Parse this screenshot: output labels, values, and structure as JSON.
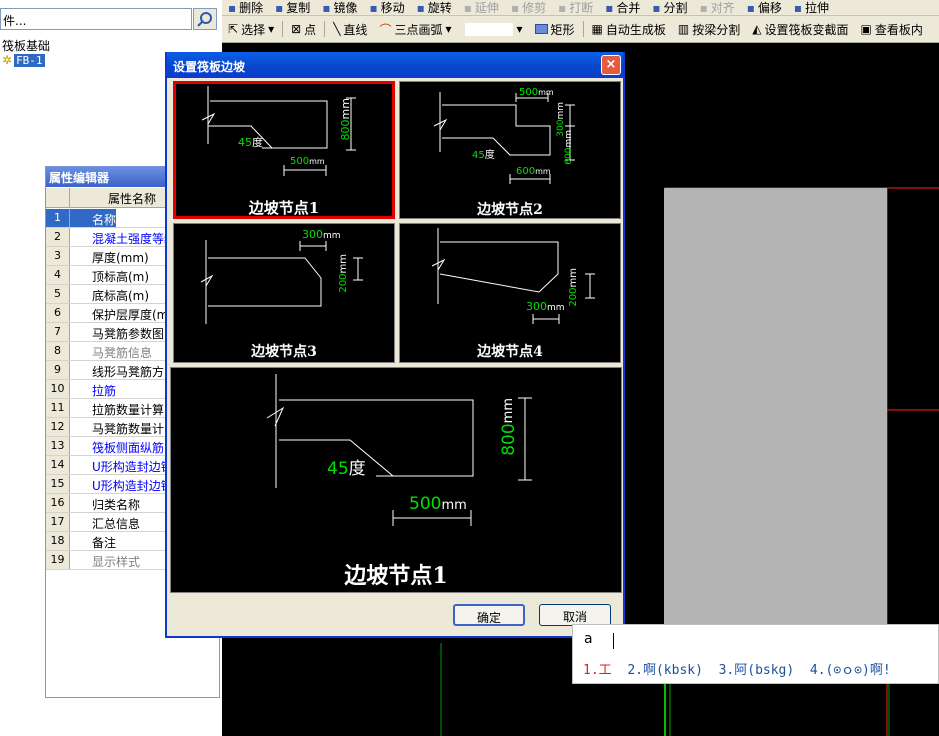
{
  "toolbar_top": {
    "items": [
      {
        "label": "删除",
        "disabled": false
      },
      {
        "label": "复制",
        "disabled": false
      },
      {
        "label": "镜像",
        "disabled": false
      },
      {
        "label": "移动",
        "disabled": false
      },
      {
        "label": "旋转",
        "disabled": false
      },
      {
        "label": "延伸",
        "disabled": true
      },
      {
        "label": "修剪",
        "disabled": true
      },
      {
        "label": "打断",
        "disabled": true
      },
      {
        "label": "合并",
        "disabled": false
      },
      {
        "label": "分割",
        "disabled": false
      },
      {
        "label": "对齐",
        "disabled": true
      },
      {
        "label": "偏移",
        "disabled": false
      },
      {
        "label": "拉伸",
        "disabled": false
      }
    ]
  },
  "toolbar_main": {
    "select": "选择",
    "point": "点",
    "line": "直线",
    "arc": "三点画弧",
    "rect": "矩形",
    "auto": "自动生成板",
    "beam_split": "按梁分割",
    "set_section": "设置筏板变截面",
    "view": "查看板内"
  },
  "left": {
    "search_text": "件...",
    "tree_root": "筏板基础",
    "tree_item": "FB-1"
  },
  "props": {
    "title": "属性编辑器",
    "col_name": "属性名称",
    "rows": [
      {
        "n": "1",
        "name": "名称",
        "style": "sel"
      },
      {
        "n": "2",
        "name": "混凝土强度等级",
        "style": "blue"
      },
      {
        "n": "3",
        "name": "厚度(mm)",
        "style": ""
      },
      {
        "n": "4",
        "name": "顶标高(m)",
        "style": ""
      },
      {
        "n": "5",
        "name": "底标高(m)",
        "style": ""
      },
      {
        "n": "6",
        "name": "保护层厚度(mm)",
        "style": ""
      },
      {
        "n": "7",
        "name": "马凳筋参数图",
        "style": ""
      },
      {
        "n": "8",
        "name": "马凳筋信息",
        "style": "gray"
      },
      {
        "n": "9",
        "name": "线形马凳筋方",
        "style": ""
      },
      {
        "n": "10",
        "name": "拉筋",
        "style": "blue"
      },
      {
        "n": "11",
        "name": "拉筋数量计算",
        "style": ""
      },
      {
        "n": "12",
        "name": "马凳筋数量计",
        "style": ""
      },
      {
        "n": "13",
        "name": "筏板侧面纵筋",
        "style": "blue"
      },
      {
        "n": "14",
        "name": "U形构造封边钢",
        "style": "blue"
      },
      {
        "n": "15",
        "name": "U形构造封边钢",
        "style": "blue"
      },
      {
        "n": "16",
        "name": "归类名称",
        "style": ""
      },
      {
        "n": "17",
        "name": "汇总信息",
        "style": ""
      },
      {
        "n": "18",
        "name": "备注",
        "style": ""
      },
      {
        "n": "19",
        "name": "显示样式",
        "style": "gray"
      }
    ]
  },
  "dialog": {
    "title": "设置筏板边坡",
    "close": "×",
    "ok": "确定",
    "cancel": "取消",
    "nodes": [
      {
        "label": "边坡节点1",
        "dims": {
          "angle_num": "45",
          "angle_unit": "度",
          "h": "800",
          "h_unit": "mm",
          "w": "500",
          "w_unit": "mm"
        }
      },
      {
        "label": "边坡节点2",
        "dims": {
          "top": "500",
          "top_unit": "mm",
          "h1": "300",
          "h1_unit": "mm",
          "h2": "600",
          "h2_unit": "mm",
          "angle_num": "45",
          "angle_unit": "度",
          "w": "600",
          "w_unit": "mm"
        }
      },
      {
        "label": "边坡节点3",
        "dims": {
          "w": "300",
          "w_unit": "mm",
          "h": "200",
          "h_unit": "mm"
        }
      },
      {
        "label": "边坡节点4",
        "dims": {
          "w": "300",
          "w_unit": "mm",
          "h": "200",
          "h_unit": "mm"
        }
      }
    ],
    "preview": {
      "label": "边坡节点1",
      "angle_num": "45",
      "angle_unit": "度",
      "h": "800",
      "h_unit": "mm",
      "w": "500",
      "w_unit": "mm"
    }
  },
  "ime": {
    "input": "a",
    "cand1": "1.工",
    "cand2": "2.啊(kbsk)",
    "cand3": "3.阿(bskg)",
    "cand4": "4.(⊙ｏ⊙)啊!"
  },
  "colors": {
    "accent": "#0a3ad0",
    "dim_green": "#00e000",
    "selection_red": "#e00000",
    "grid_red": "#ff2020"
  }
}
